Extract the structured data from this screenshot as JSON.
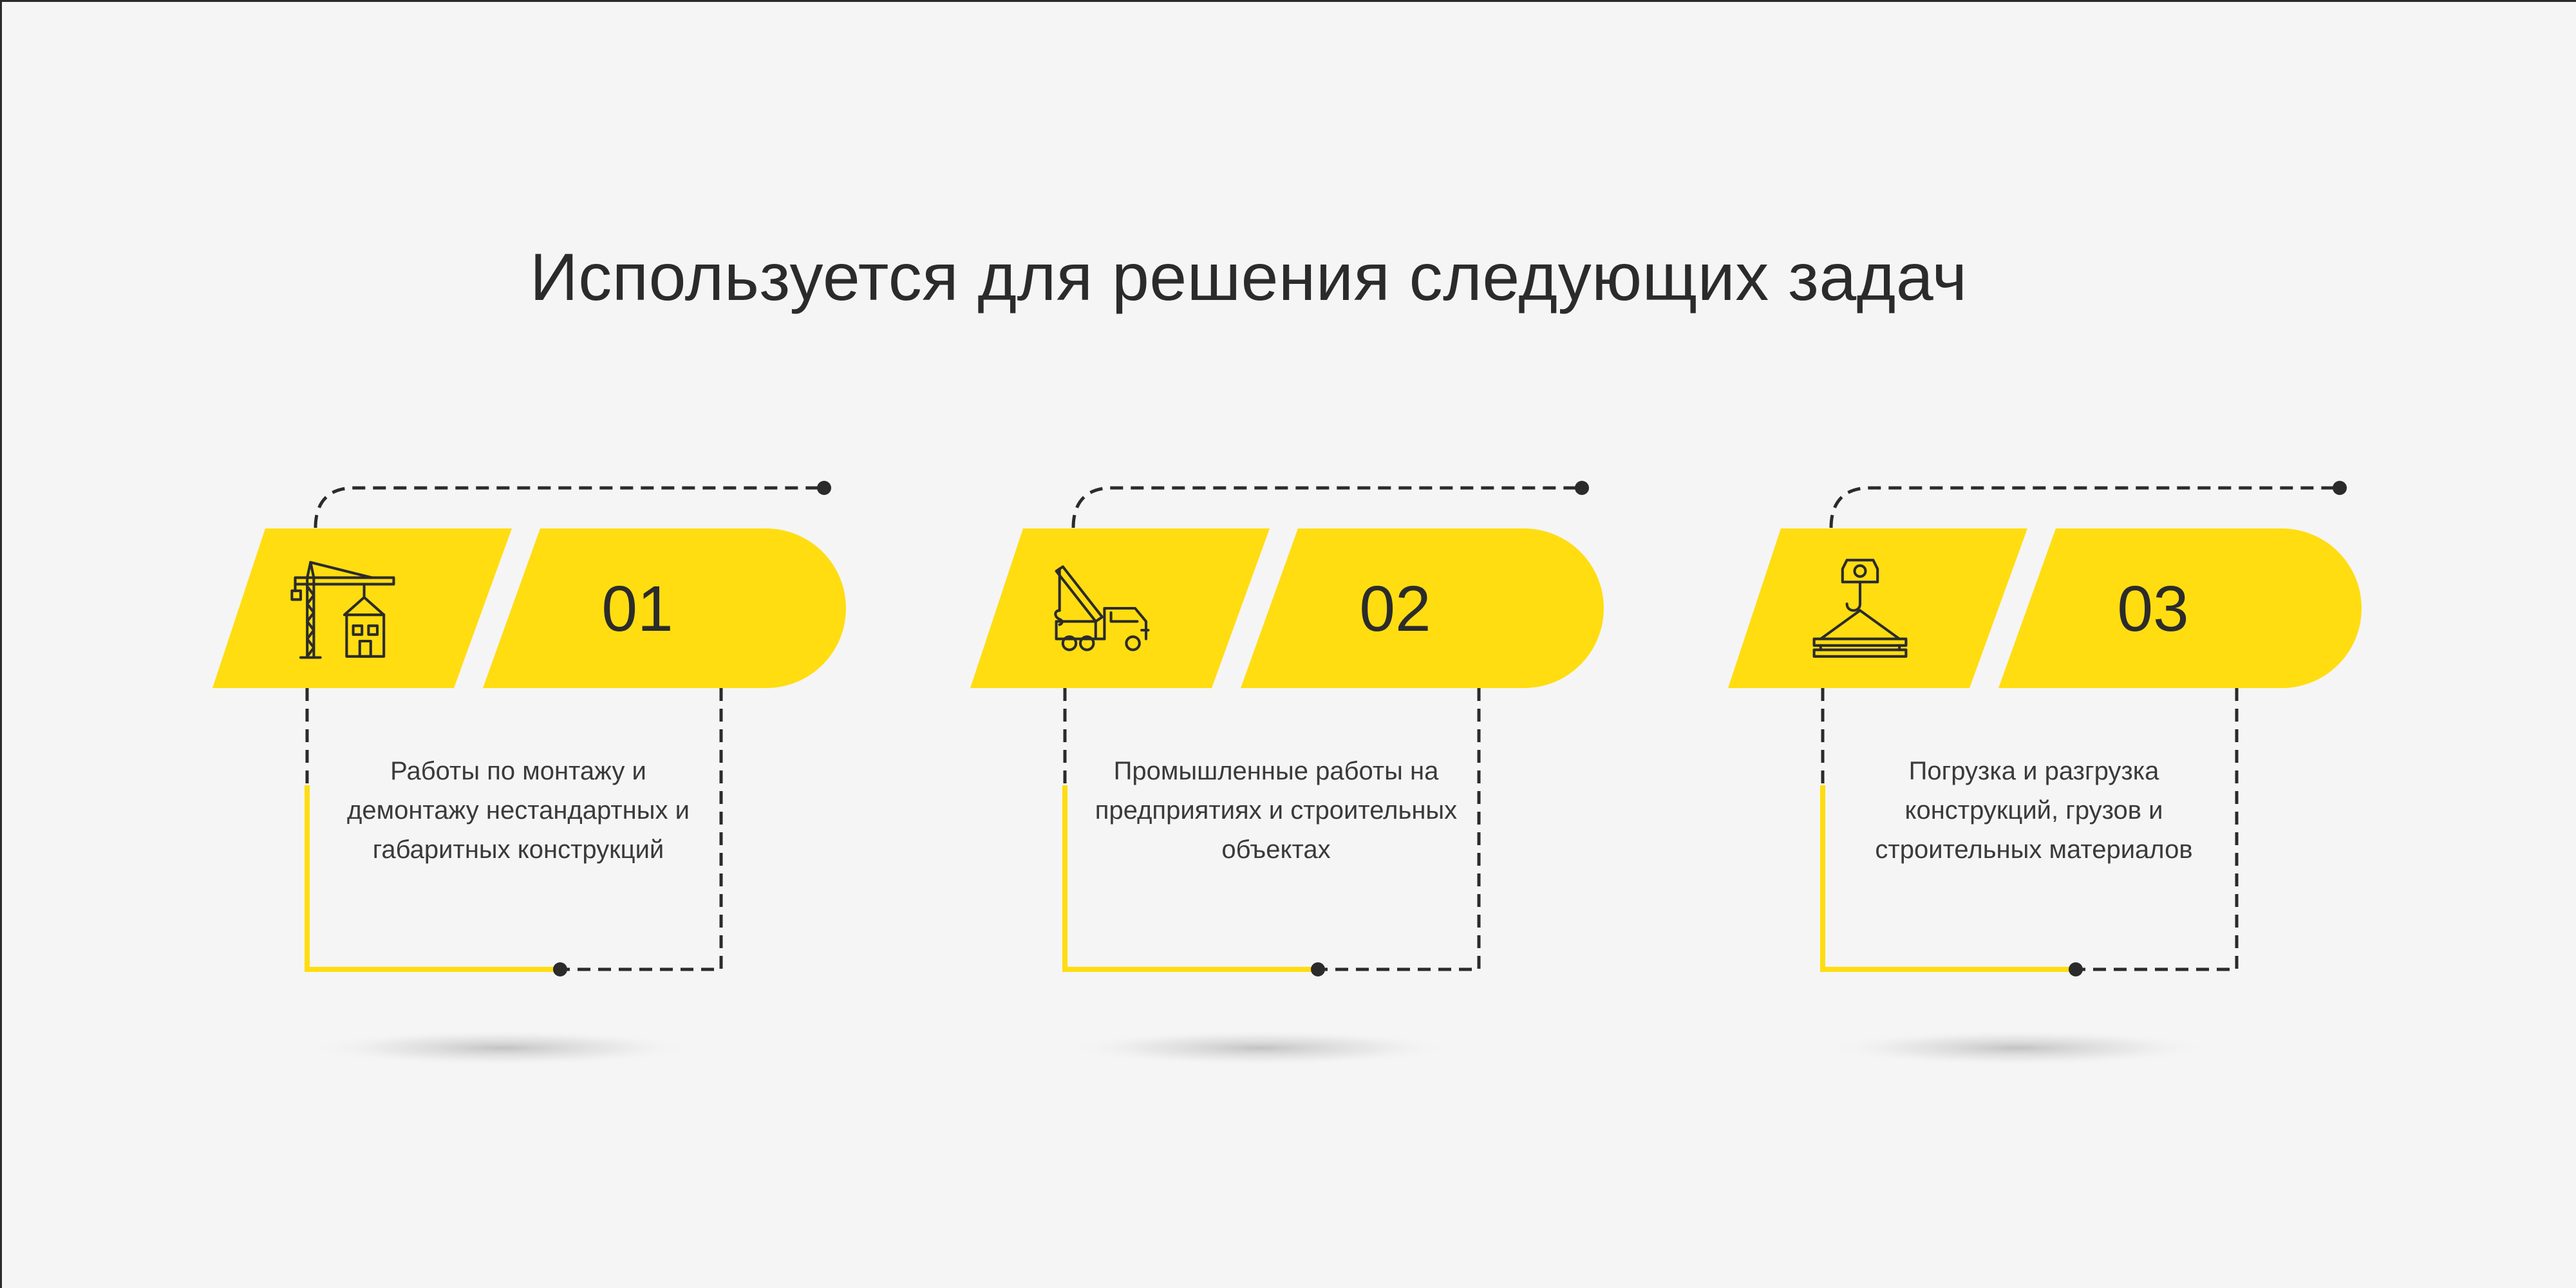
{
  "title": "Используется для решения следующих задач",
  "cards": [
    {
      "number": "01",
      "icon": "tower-crane-house-icon",
      "text": "Работы по монтажу и демонтажу нестандартных и габаритных конструкций"
    },
    {
      "number": "02",
      "icon": "crane-truck-icon",
      "text": "Промышленные работы на предприятиях и строительных объектах"
    },
    {
      "number": "03",
      "icon": "crane-hook-load-icon",
      "text": "Погрузка и разгрузка конструкций, грузов и строительных материалов"
    }
  ],
  "colors": {
    "accent": "#FFDD11",
    "text": "#2b2b2b",
    "background": "#f5f5f5"
  }
}
